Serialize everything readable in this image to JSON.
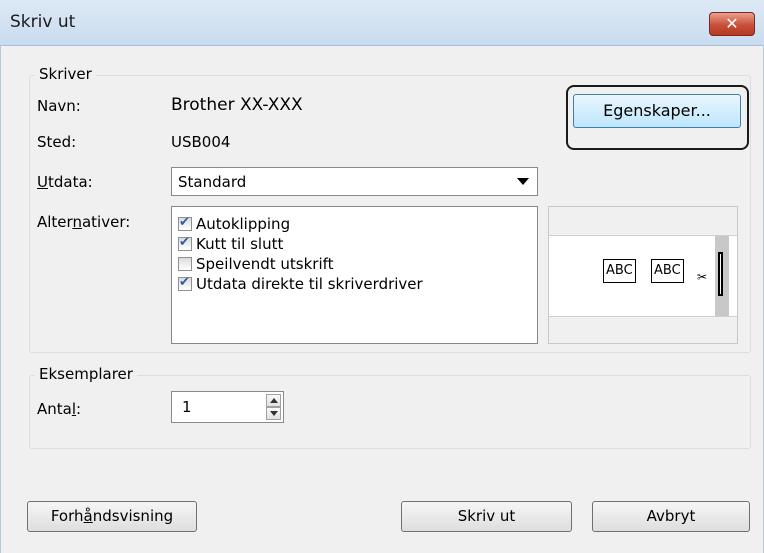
{
  "window": {
    "title": "Skriv ut",
    "close_glyph": "✕"
  },
  "printer_group": {
    "legend": "Skriver",
    "name_label": "Navn:",
    "name_value": "Brother XX-XXX",
    "location_label": "Sted:",
    "location_value": "USB004",
    "properties_button": "Egenskaper...",
    "output_label_pre": "",
    "output_label_u": "U",
    "output_label_post": "tdata:",
    "output_value": "Standard",
    "options_label_pre": "Alter",
    "options_label_u": "n",
    "options_label_post": "ativer:",
    "options": [
      {
        "label": "Autoklipping",
        "checked": true
      },
      {
        "label": "Kutt til slutt",
        "checked": true
      },
      {
        "label": "Speilvendt utskrift",
        "checked": false
      },
      {
        "label": "Utdata direkte til skriverdriver",
        "checked": true
      }
    ],
    "preview": {
      "label1": "ABC",
      "label2": "ABC",
      "cut_glyph": "✂"
    }
  },
  "copies_group": {
    "legend": "Eksemplarer",
    "count_label_pre": "Anta",
    "count_label_u": "l",
    "count_label_post": ":",
    "count_value": "1"
  },
  "buttons": {
    "preview_pre": "Forh",
    "preview_u": "å",
    "preview_post": "ndsvisning",
    "print": "Skriv ut",
    "cancel": "Avbryt"
  },
  "colors": {
    "title_bar": "#c9dcef",
    "close_button": "#c8503a",
    "checkmark": "#2b5ea8"
  }
}
